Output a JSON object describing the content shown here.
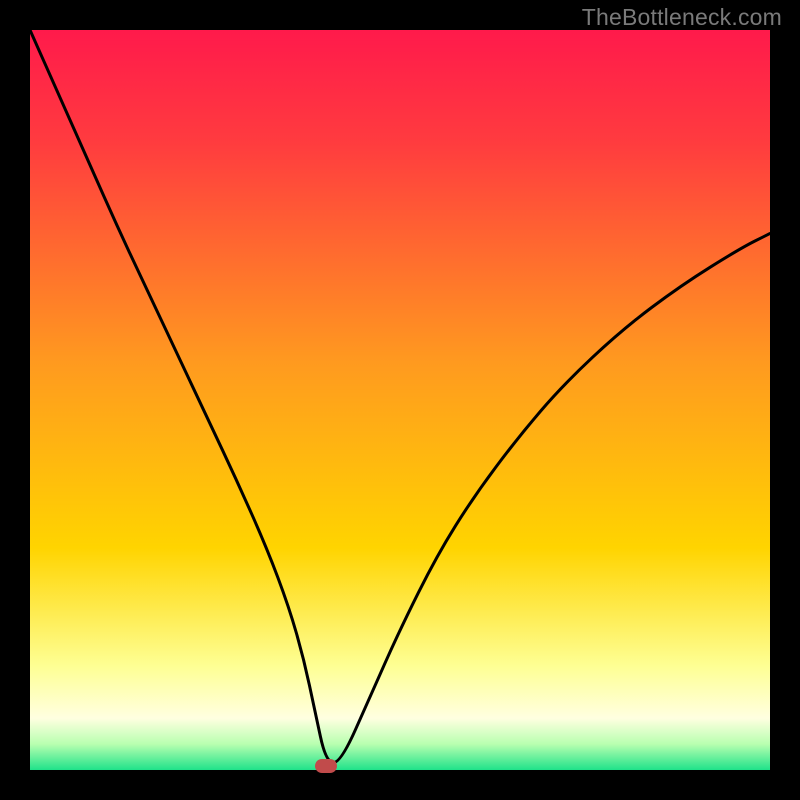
{
  "watermark": {
    "text": "TheBottleneck.com"
  },
  "colors": {
    "frame_bg": "#000000",
    "watermark": "#7a7a7a",
    "curve": "#000000",
    "marker": "#c14b4b",
    "gradient_top": "#ff1a4b",
    "gradient_mid": "#ffd400",
    "gradient_pale": "#ffffc4",
    "gradient_bottom": "#1fe28a"
  },
  "chart_data": {
    "type": "line",
    "title": "",
    "xlabel": "",
    "ylabel": "",
    "xlim": [
      0,
      100
    ],
    "ylim": [
      0,
      100
    ],
    "grid": false,
    "legend": false,
    "series": [
      {
        "name": "bottleneck-curve",
        "x": [
          0,
          4,
          8,
          12,
          16,
          20,
          24,
          28,
          32,
          35,
          37,
          38.5,
          40,
          42,
          46,
          50,
          55,
          60,
          66,
          72,
          80,
          88,
          96,
          100
        ],
        "y": [
          100,
          91,
          82,
          73,
          64.5,
          56,
          47.5,
          39,
          30,
          22,
          15,
          8,
          1,
          1,
          10,
          19,
          29,
          37,
          45,
          52,
          59.5,
          65.5,
          70.5,
          72.5
        ]
      }
    ],
    "marker": {
      "x": 40,
      "y": 0.6
    },
    "background_gradient": {
      "direction": "vertical",
      "stops": [
        {
          "offset": 0.0,
          "color": "#ff1a4b"
        },
        {
          "offset": 0.15,
          "color": "#ff3b3f"
        },
        {
          "offset": 0.45,
          "color": "#ff9a1f"
        },
        {
          "offset": 0.7,
          "color": "#ffd400"
        },
        {
          "offset": 0.86,
          "color": "#feff94"
        },
        {
          "offset": 0.93,
          "color": "#ffffe0"
        },
        {
          "offset": 0.965,
          "color": "#b8ffb0"
        },
        {
          "offset": 1.0,
          "color": "#1fe28a"
        }
      ]
    }
  }
}
